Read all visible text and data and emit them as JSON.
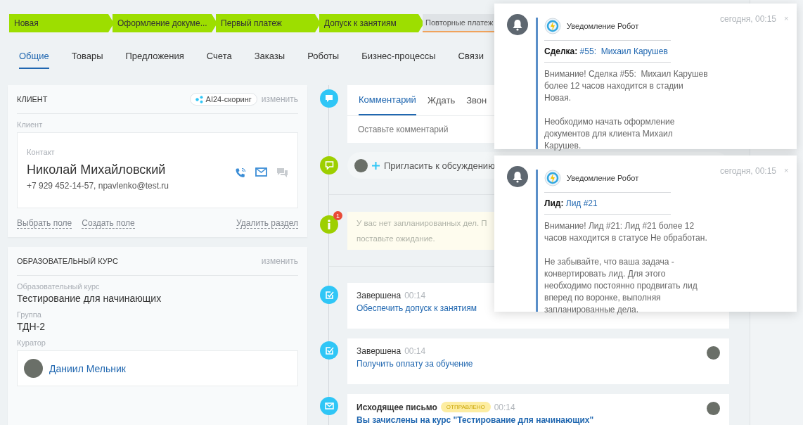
{
  "stages": [
    {
      "label": "Новая",
      "done": true
    },
    {
      "label": "Оформление докуме...",
      "done": true
    },
    {
      "label": "Первый платеж",
      "done": true
    },
    {
      "label": "Допуск к занятиям",
      "done": true
    },
    {
      "label": "Повторные платеж",
      "done": false
    }
  ],
  "tabs": [
    {
      "label": "Общие",
      "selected": true
    },
    {
      "label": "Товары",
      "selected": false
    },
    {
      "label": "Предложения",
      "selected": false
    },
    {
      "label": "Счета",
      "selected": false
    },
    {
      "label": "Заказы",
      "selected": false
    },
    {
      "label": "Роботы",
      "selected": false
    },
    {
      "label": "Бизнес-процессы",
      "selected": false
    },
    {
      "label": "Связи",
      "selected": false
    }
  ],
  "client_section": {
    "title": "КЛИЕНТ",
    "scoring_badge": "AI24-скоринг",
    "edit_link": "изменить",
    "field_label": "Клиент",
    "contact": {
      "label": "Контакт",
      "name": "Николай Михайловский",
      "details": "+7 929 452-14-57, npavlenko@test.ru"
    },
    "actions": [
      "Выбрать поле",
      "Создать поле"
    ],
    "delete_action": "Удалить раздел"
  },
  "course_section": {
    "title": "ОБРАЗОВАТЕЛЬНЫЙ КУРС",
    "edit_link": "изменить",
    "fields": [
      {
        "kind": "text",
        "label": "Образовательный курс",
        "value": "Тестирование для начинающих"
      },
      {
        "kind": "text",
        "label": "Группа",
        "value": "ТДН-2"
      },
      {
        "kind": "user",
        "label": "Куратор",
        "value": "Даниил Мельник"
      }
    ]
  },
  "timeline": {
    "composer": {
      "tabs": [
        {
          "label": "Комментарий",
          "selected": true
        },
        {
          "label": "Ждать",
          "selected": false
        },
        {
          "label": "Звон",
          "selected": false
        }
      ],
      "placeholder": "Оставьте комментарий"
    },
    "invite": "Пригласить к обсуждению",
    "notice": {
      "badge": "1",
      "lines": [
        "У вас нет запланированных дел. П",
        "поставьте ожидание."
      ]
    },
    "items": [
      {
        "kind": "task",
        "title": "Завершена",
        "time": "00:14",
        "link": "Обеспечить допуск к занятиям"
      },
      {
        "kind": "task",
        "title": "Завершена",
        "time": "00:14",
        "link": "Получить оплату за обучение",
        "has_avatar": true
      },
      {
        "kind": "email",
        "title": "Исходящее письмо",
        "status": "ОТПРАВЛЕНО",
        "time": "00:14",
        "link": "Вы зачислены на курс \"Тестирование для начинающих\"",
        "has_avatar": true
      }
    ]
  },
  "notifications": [
    {
      "sender": "Уведомление Робот",
      "time": "сегодня, 00:15",
      "close": "×",
      "entity_label": "Сделка:",
      "entity_link": "#55:  Михаил Карушев",
      "paragraphs": [
        "Внимание! Сделка #55:  Михаил Карушев более 12 часов находится в стадии Новая.",
        "Необходимо начать оформление документов для клиента Михаил Карушев."
      ]
    },
    {
      "sender": "Уведомление Робот",
      "time": "сегодня, 00:15",
      "close": "×",
      "entity_label": "Лид:",
      "entity_link": "Лид #21",
      "paragraphs": [
        "Внимание! Лид #21: Лид #21 более 12 часов находится в статусе Не обработан.",
        "Не забывайте, что ваша задача - конвертировать лид. Для этого необходимо постоянно продвигать лид вперед по воронке, выполняя запланированные дела."
      ]
    }
  ]
}
